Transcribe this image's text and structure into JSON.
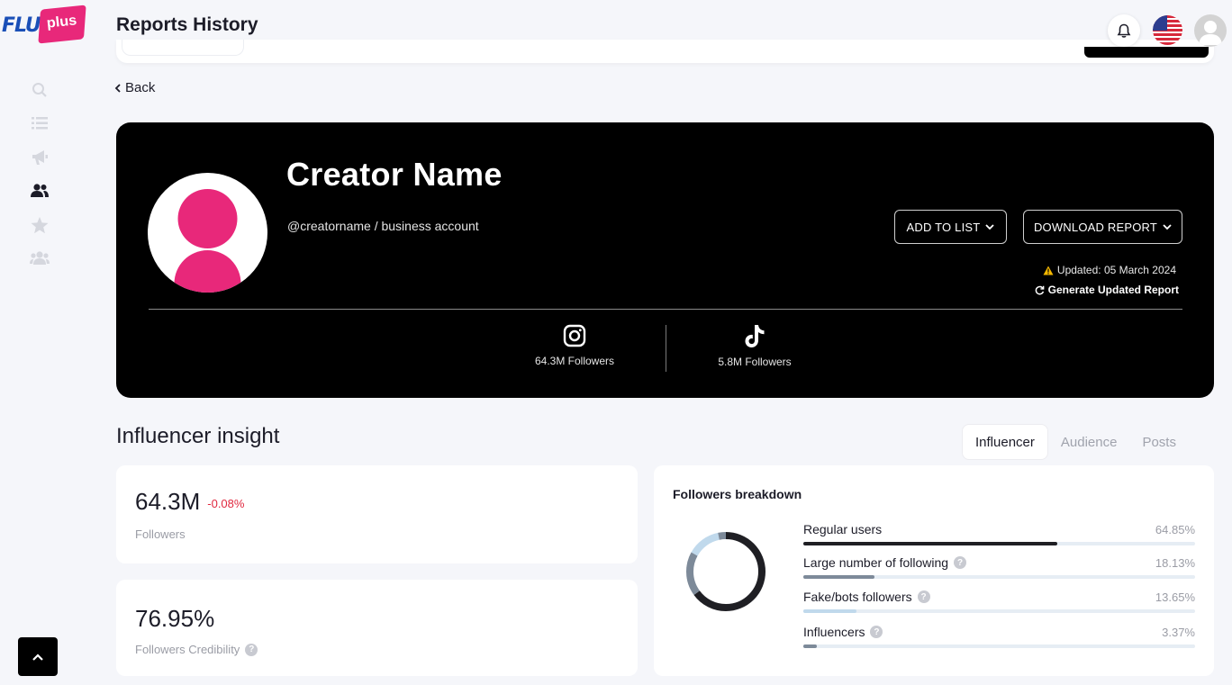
{
  "brand": {
    "logo_text_left": "FLU",
    "logo_text_right": "plus"
  },
  "header": {
    "title": "Reports History"
  },
  "sidebar": {
    "items": [
      {
        "name": "search-icon",
        "active": false
      },
      {
        "name": "list-icon",
        "active": false
      },
      {
        "name": "megaphone-icon",
        "active": false
      },
      {
        "name": "users-icon",
        "active": true
      },
      {
        "name": "star-icon",
        "active": false
      },
      {
        "name": "group-icon",
        "active": false
      }
    ]
  },
  "nav": {
    "back_label": "Back"
  },
  "profile": {
    "name": "Creator Name",
    "handle": "@creatorname / business account",
    "add_to_list": "ADD TO LIST",
    "download_report": "DOWNLOAD REPORT",
    "updated": "Updated: 05 March 2024",
    "regenerate": "Generate Updated Report",
    "socials": [
      {
        "platform": "instagram-icon",
        "followers": "64.3M Followers"
      },
      {
        "platform": "tiktok-icon",
        "followers": "5.8M Followers"
      }
    ]
  },
  "insight": {
    "title": "Influencer insight",
    "tabs": [
      "Influencer",
      "Audience",
      "Posts"
    ],
    "active_tab": "Influencer",
    "followers": {
      "value": "64.3M",
      "change": "-0.08%",
      "label": "Followers"
    },
    "credibility": {
      "value": "76.95%",
      "label": "Followers Credibility"
    },
    "breakdown": {
      "title": "Followers breakdown",
      "rows": [
        {
          "label": "Regular users",
          "pct": "64.85%",
          "value": 64.85,
          "color": "#1f1f24",
          "help": false
        },
        {
          "label": "Large number of following",
          "pct": "18.13%",
          "value": 18.13,
          "color": "#7d8a99",
          "help": true
        },
        {
          "label": "Fake/bots followers",
          "pct": "13.65%",
          "value": 13.65,
          "color": "#c0d9ec",
          "help": true
        },
        {
          "label": "Influencers",
          "pct": "3.37%",
          "value": 3.37,
          "color": "#7d8a99",
          "help": true
        }
      ]
    }
  },
  "colors": {
    "accent_pink": "#e8287a",
    "danger": "#e0283f",
    "card_dark": "#000000"
  }
}
